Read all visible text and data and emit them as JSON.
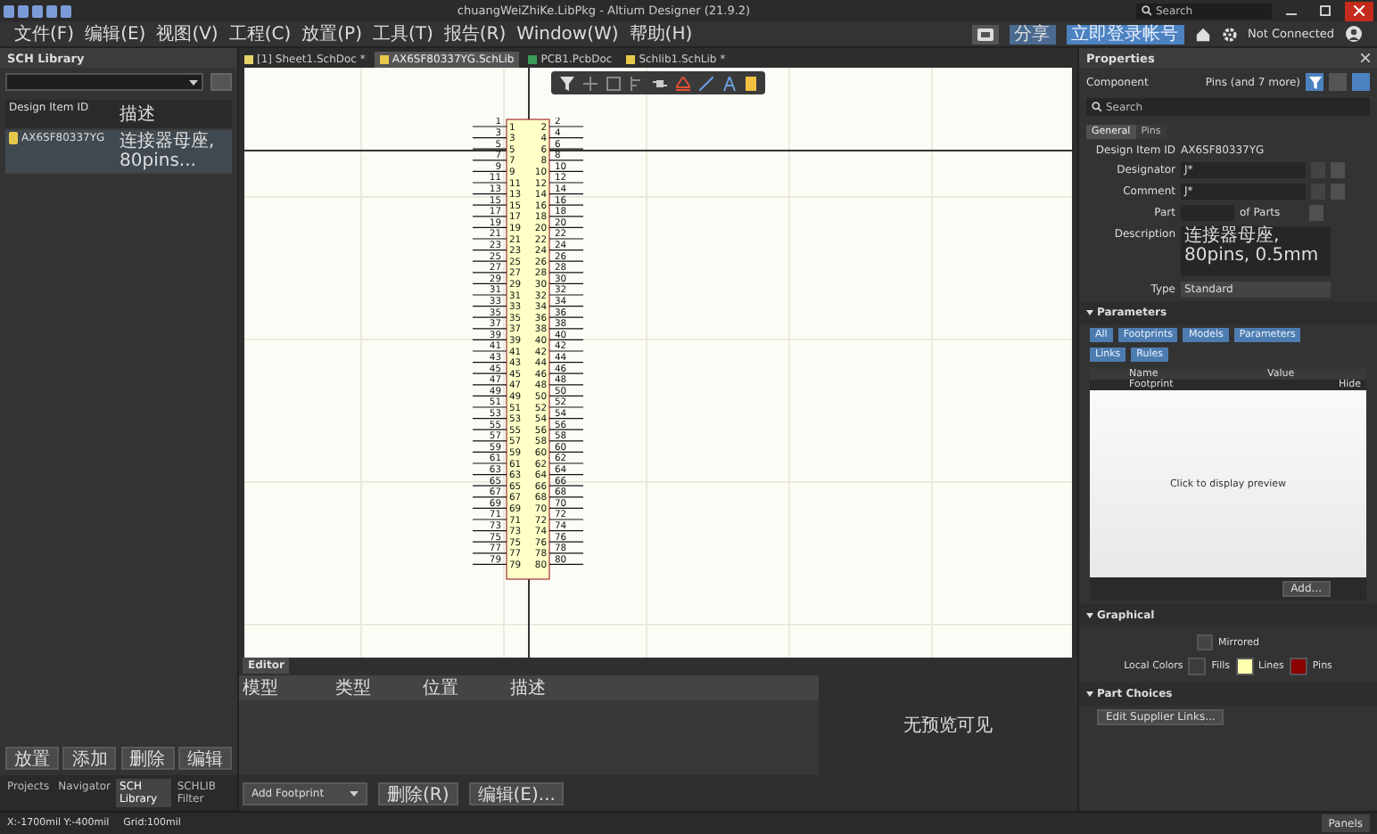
{
  "window": {
    "title": "chuangWeiZhiKe.LibPkg - Altium Designer (21.9.2)",
    "search_placeholder": "Search"
  },
  "menu": [
    "文件(F)",
    "编辑(E)",
    "视图(V)",
    "工程(C)",
    "放置(P)",
    "工具(T)",
    "报告(R)",
    "Window(W)",
    "帮助(H)"
  ],
  "account": {
    "share": "分享",
    "login": "立即登录帐号",
    "connection": "Not Connected"
  },
  "left_panel": {
    "title": "SCH Library",
    "columns": [
      "Design Item ID",
      "描述"
    ],
    "rows": [
      {
        "id": "AX6SF80337YG",
        "description": "连接器母座, 80pins...",
        "selected": true
      }
    ],
    "buttons": [
      "放置",
      "添加",
      "删除",
      "编辑"
    ],
    "tabs": [
      {
        "label": "Projects",
        "selected": false
      },
      {
        "label": "Navigator",
        "selected": false
      },
      {
        "label": "SCH Library",
        "selected": true
      },
      {
        "label": "SCHLIB Filter",
        "selected": false
      }
    ]
  },
  "document_tabs": [
    {
      "label": "[1] Sheet1.SchDoc *",
      "kind": "sch",
      "selected": false
    },
    {
      "label": "AX6SF80337YG.SchLib",
      "kind": "lib",
      "selected": true
    },
    {
      "label": "PCB1.PcbDoc",
      "kind": "pcb",
      "selected": false
    },
    {
      "label": "Schlib1.SchLib *",
      "kind": "lib",
      "selected": false
    }
  ],
  "component": {
    "pins": [
      {
        "number": "1",
        "name": "1"
      },
      {
        "number": "2",
        "name": "2"
      },
      {
        "number": "3",
        "name": "3"
      },
      {
        "number": "4",
        "name": "4"
      },
      {
        "number": "5",
        "name": "5"
      },
      {
        "number": "6",
        "name": "6"
      },
      {
        "number": "7",
        "name": "7"
      },
      {
        "number": "8",
        "name": "8"
      },
      {
        "number": "9",
        "name": "9"
      },
      {
        "number": "10",
        "name": "10"
      },
      {
        "number": "11",
        "name": "11"
      },
      {
        "number": "12",
        "name": "12"
      },
      {
        "number": "13",
        "name": "13"
      },
      {
        "number": "14",
        "name": "14"
      },
      {
        "number": "15",
        "name": "15"
      },
      {
        "number": "16",
        "name": "16"
      },
      {
        "number": "17",
        "name": "17"
      },
      {
        "number": "18",
        "name": "18"
      },
      {
        "number": "19",
        "name": "19"
      },
      {
        "number": "20",
        "name": "20"
      },
      {
        "number": "21",
        "name": "21"
      },
      {
        "number": "22",
        "name": "22"
      },
      {
        "number": "23",
        "name": "23"
      },
      {
        "number": "24",
        "name": "24"
      },
      {
        "number": "25",
        "name": "25"
      },
      {
        "number": "26",
        "name": "26"
      },
      {
        "number": "27",
        "name": "27"
      },
      {
        "number": "28",
        "name": "28"
      },
      {
        "number": "29",
        "name": "29"
      },
      {
        "number": "30",
        "name": "30"
      },
      {
        "number": "31",
        "name": "31"
      },
      {
        "number": "32",
        "name": "32"
      },
      {
        "number": "33",
        "name": "33"
      },
      {
        "number": "34",
        "name": "34"
      },
      {
        "number": "35",
        "name": "35"
      },
      {
        "number": "36",
        "name": "36"
      },
      {
        "number": "37",
        "name": "37"
      },
      {
        "number": "38",
        "name": "38"
      },
      {
        "number": "39",
        "name": "39"
      },
      {
        "number": "40",
        "name": "40"
      },
      {
        "number": "41",
        "name": "41"
      },
      {
        "number": "42",
        "name": "42"
      },
      {
        "number": "43",
        "name": "43"
      },
      {
        "number": "44",
        "name": "44"
      },
      {
        "number": "45",
        "name": "45"
      },
      {
        "number": "46",
        "name": "46"
      },
      {
        "number": "47",
        "name": "47"
      },
      {
        "number": "48",
        "name": "48"
      },
      {
        "number": "49",
        "name": "49"
      },
      {
        "number": "50",
        "name": "50"
      },
      {
        "number": "51",
        "name": "51"
      },
      {
        "number": "52",
        "name": "52"
      },
      {
        "number": "53",
        "name": "53"
      },
      {
        "number": "54",
        "name": "54"
      },
      {
        "number": "55",
        "name": "55"
      },
      {
        "number": "56",
        "name": "56"
      },
      {
        "number": "57",
        "name": "57"
      },
      {
        "number": "58",
        "name": "58"
      },
      {
        "number": "59",
        "name": "59"
      },
      {
        "number": "60",
        "name": "60"
      },
      {
        "number": "61",
        "name": "61"
      },
      {
        "number": "62",
        "name": "62"
      },
      {
        "number": "63",
        "name": "63"
      },
      {
        "number": "64",
        "name": "64"
      },
      {
        "number": "65",
        "name": "65"
      },
      {
        "number": "66",
        "name": "66"
      },
      {
        "number": "67",
        "name": "67"
      },
      {
        "number": "68",
        "name": "68"
      },
      {
        "number": "69",
        "name": "69"
      },
      {
        "number": "70",
        "name": "70"
      },
      {
        "number": "71",
        "name": "71"
      },
      {
        "number": "72",
        "name": "72"
      },
      {
        "number": "73",
        "name": "73"
      },
      {
        "number": "74",
        "name": "74"
      },
      {
        "number": "75",
        "name": "75"
      },
      {
        "number": "76",
        "name": "76"
      },
      {
        "number": "77",
        "name": "77"
      },
      {
        "number": "78",
        "name": "78"
      },
      {
        "number": "79",
        "name": "79"
      },
      {
        "number": "80",
        "name": "80"
      }
    ]
  },
  "editor": {
    "tab": "Editor",
    "columns": [
      "模型",
      "类型",
      "位置",
      "描述"
    ],
    "preview_text": "无预览可见",
    "buttons": [
      "Add Footprint",
      "删除(R)",
      "编辑(E)..."
    ]
  },
  "properties": {
    "title": "Properties",
    "object": "Component",
    "filter": "Pins (and 7 more)",
    "search_placeholder": "Search",
    "tabs": [
      {
        "label": "General",
        "selected": true
      },
      {
        "label": "Pins",
        "selected": false
      }
    ],
    "fields": [
      {
        "label": "Design Item ID",
        "value": "AX6SF80337YG",
        "kind": "plain"
      },
      {
        "label": "Designator",
        "value": "J*",
        "kind": "text"
      },
      {
        "label": "Comment",
        "value": "J*",
        "kind": "text"
      },
      {
        "label": "Part",
        "value": "of Parts",
        "kind": "part"
      },
      {
        "label": "Description",
        "value": "连接器母座, 80pins, 0.5mm",
        "kind": "area"
      },
      {
        "label": "Type",
        "value": "Standard",
        "kind": "select"
      }
    ],
    "parameters_title": "Parameters",
    "filters": [
      "All",
      "Footprints",
      "Models",
      "Parameters",
      "Links",
      "Rules"
    ],
    "table_columns": [
      "Name",
      "Value"
    ],
    "table_rows": [
      {
        "name": "Footprint",
        "value": "Hide"
      }
    ],
    "preview_text": "Click to display preview",
    "add_button": "Add...",
    "graphical_title": "Graphical",
    "mirrored": {
      "label": "Mirrored",
      "checked": false
    },
    "local_colors_label": "Local Colors",
    "local_colors": [
      {
        "label": "Fills",
        "color": "#3c3c3c"
      },
      {
        "label": "Lines",
        "color": "#ffffb0"
      },
      {
        "label": "Pins",
        "color": "#8b0000"
      }
    ],
    "part_choices_title": "Part Choices",
    "part_choices_button": "Edit Supplier Links..."
  },
  "status_bar": {
    "coordinates": "X:-1700mil Y:-400mil",
    "grid": "Grid:100mil",
    "panels_button": "Panels"
  }
}
